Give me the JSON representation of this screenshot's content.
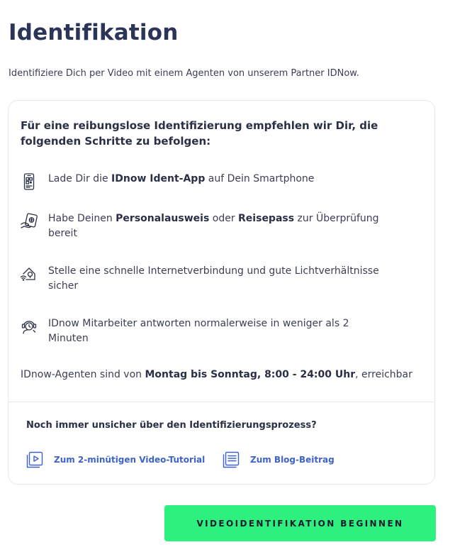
{
  "page": {
    "title": "Identifikation",
    "subtitle": "Identifiziere Dich per Video mit einem Agenten von unserem Partner IDNow."
  },
  "card": {
    "heading": "Für eine reibungslose Identifizierung empfehlen wir Dir, die folgenden Schritte zu befolgen:",
    "steps": [
      {
        "icon": "smartphone-qr-icon",
        "parts": [
          {
            "text": "Lade Dir die ",
            "bold": false
          },
          {
            "text": "IDnow Ident-App",
            "bold": true
          },
          {
            "text": " auf Dein Smartphone",
            "bold": false
          }
        ]
      },
      {
        "icon": "id-card-hand-icon",
        "parts": [
          {
            "text": "Habe Deinen ",
            "bold": false
          },
          {
            "text": "Personalausweis",
            "bold": true
          },
          {
            "text": " oder ",
            "bold": false
          },
          {
            "text": "Reisepass",
            "bold": true
          },
          {
            "text": " zur Überprüfung bereit",
            "bold": false
          }
        ]
      },
      {
        "icon": "wifi-light-icon",
        "parts": [
          {
            "text": "Stelle eine schnelle Internetverbindung und gute Lichtverhältnisse sicher",
            "bold": false
          }
        ]
      },
      {
        "icon": "agent-clock-icon",
        "parts": [
          {
            "text": "IDnow Mitarbeiter antworten normalerweise in weniger als 2 Minuten",
            "bold": false
          }
        ]
      }
    ],
    "availability": {
      "prefix": "IDnow-Agenten sind von ",
      "hours": "Montag bis Sonntag, 8:00 - 24:00 Uhr",
      "suffix": ", erreichbar"
    },
    "help": {
      "question": "Noch immer unsicher über den Identifizierungsprozess?",
      "video_link": "Zum 2-minütigen Video-Tutorial",
      "blog_link": "Zum Blog-Beitrag"
    }
  },
  "cta": {
    "label": "VIDEOIDENTIFIKATION BEGINNEN"
  },
  "colors": {
    "title": "#2a3558",
    "link": "#3e62c9",
    "cta_background": "#2df07f"
  }
}
